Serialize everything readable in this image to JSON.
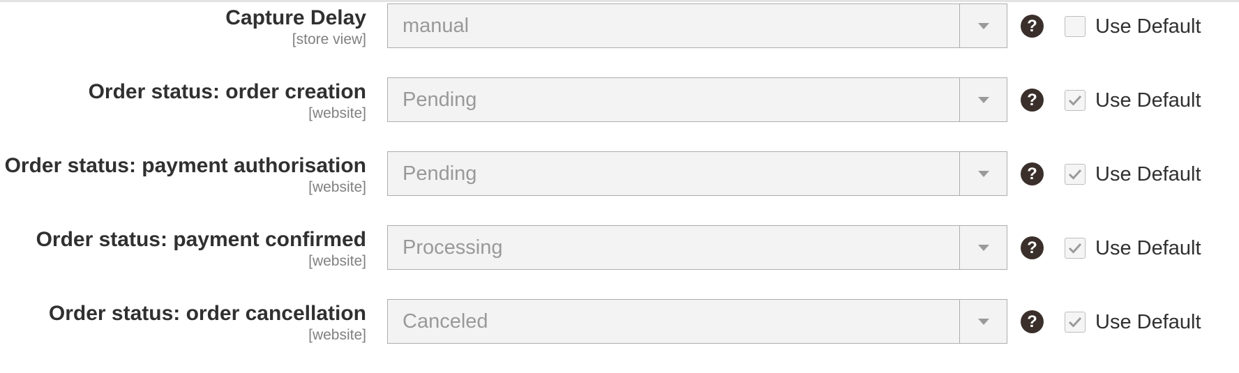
{
  "rows": [
    {
      "label": "Capture Delay",
      "scope": "[store view]",
      "value": "manual",
      "use_default_label": "Use Default",
      "use_default_checked": false
    },
    {
      "label": "Order status: order creation",
      "scope": "[website]",
      "value": "Pending",
      "use_default_label": "Use Default",
      "use_default_checked": true
    },
    {
      "label": "Order status: payment authorisation",
      "scope": "[website]",
      "value": "Pending",
      "use_default_label": "Use Default",
      "use_default_checked": true
    },
    {
      "label": "Order status: payment confirmed",
      "scope": "[website]",
      "value": "Processing",
      "use_default_label": "Use Default",
      "use_default_checked": true
    },
    {
      "label": "Order status: order cancellation",
      "scope": "[website]",
      "value": "Canceled",
      "use_default_label": "Use Default",
      "use_default_checked": true
    }
  ],
  "icons": {
    "help": "question-circle-icon",
    "dropdown": "chevron-down-icon",
    "check": "checkmark-icon"
  },
  "help_glyph": "?",
  "colors": {
    "label": "#303030",
    "scope": "#808080",
    "select_bg": "#f3f3f3",
    "select_text": "#999999",
    "help_bg": "#3a2f2a",
    "check": "#9a9a9a"
  }
}
